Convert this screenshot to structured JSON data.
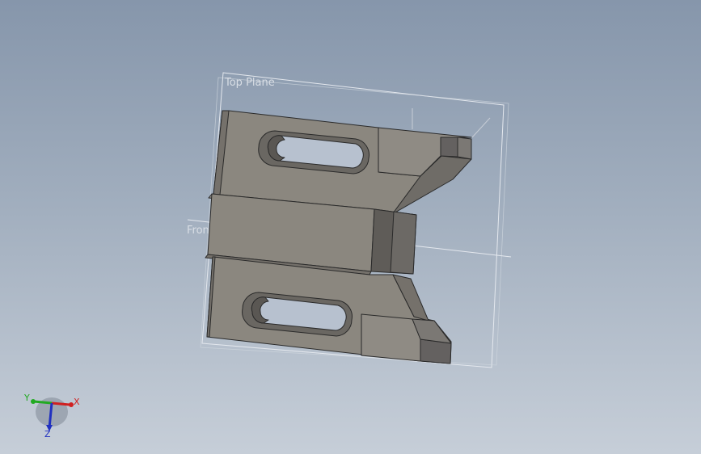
{
  "viewport": {
    "background_top": "#8696ab",
    "background_bottom": "#c6ced8"
  },
  "planes": {
    "top_plane_label": "Top Plane",
    "front_plane_label": "Fron"
  },
  "part": {
    "face_color": "#8b877f",
    "side_color": "#75716b",
    "dark_color": "#5f5c58",
    "edge_color": "#2a2a2a"
  },
  "triad": {
    "x_label": "X",
    "y_label": "Y",
    "z_label": "Z",
    "x_color": "#d02020",
    "y_color": "#22aa22",
    "z_color": "#2030c0"
  }
}
